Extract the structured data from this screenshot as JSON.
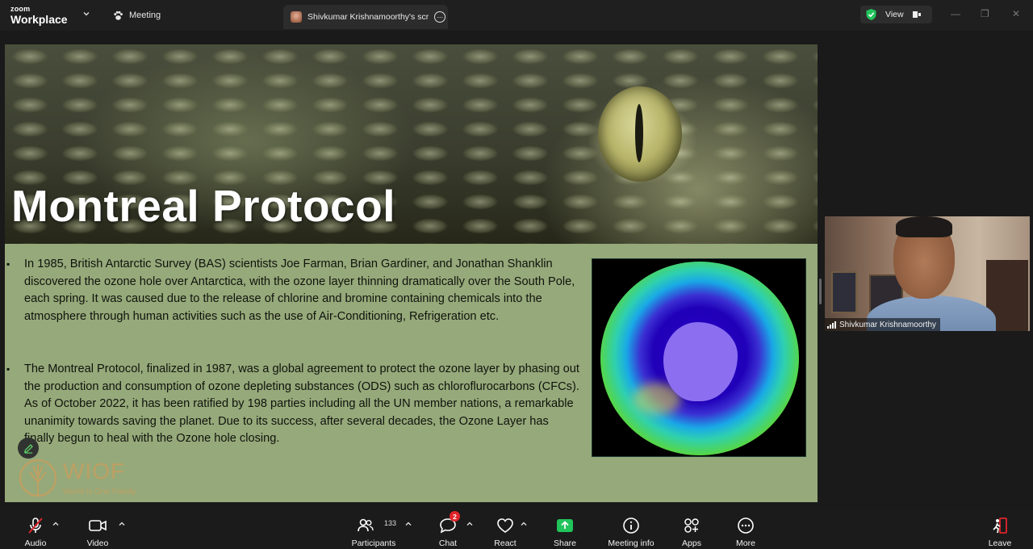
{
  "app": {
    "logo_small": "zoom",
    "logo_big": "Workplace"
  },
  "header": {
    "meeting_tab": "Meeting",
    "share_tab": "Shivkumar Krishnamoorthy's screen share",
    "view_button": "View"
  },
  "slide": {
    "title": "Montreal Protocol",
    "bullets": [
      "In 1985, British Antarctic Survey (BAS) scientists Joe Farman, Brian Gardiner, and Jonathan Shanklin discovered the ozone hole over Antarctica, with the ozone layer thinning dramatically over the South Pole, each spring.  It was caused due to the release of chlorine and bromine containing chemicals into the atmosphere through human activities such as the use of Air-Conditioning, Refrigeration etc.",
      "The Montreal Protocol, finalized in 1987, was a global agreement to protect the ozone layer by phasing out the production and consumption of ozone depleting substances (ODS) such as chloroflurocarbons (CFCs). As of October 2022, it has been ratified by 198 parties including all the UN member nations, a remarkable unanimity towards saving the planet. Due to its success, after several decades, the Ozone Layer has finally begun to heal with the Ozone hole closing."
    ],
    "bullet_mark": "▪",
    "logo_text": "WIOF",
    "logo_tagline": "World Is One Family"
  },
  "video": {
    "participant_name": "Shivkumar Krishnamoorthy"
  },
  "toolbar": {
    "audio": "Audio",
    "video": "Video",
    "participants": "Participants",
    "participants_count": "133",
    "chat": "Chat",
    "chat_badge": "2",
    "react": "React",
    "share": "Share",
    "meeting_info": "Meeting info",
    "apps": "Apps",
    "more": "More",
    "leave": "Leave"
  },
  "colors": {
    "accent_green": "#21c35b",
    "leave_red": "#e0242a",
    "slide_bg": "#96a97a"
  }
}
